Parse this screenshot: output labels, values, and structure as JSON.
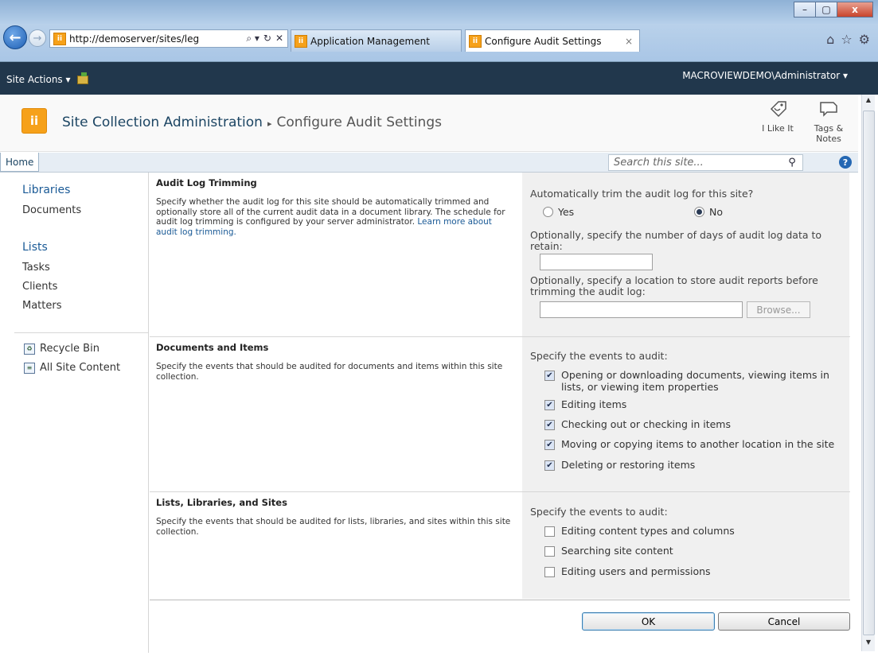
{
  "browser": {
    "url": "http://demoserver/sites/leg",
    "addr_tools": [
      "⌕ ▾",
      "↻",
      "✕"
    ],
    "tabs": [
      {
        "label": "Application Management"
      },
      {
        "label": "Configure Audit Settings",
        "close": "×"
      }
    ],
    "window_buttons": [
      "–",
      "▢",
      "x"
    ]
  },
  "ribbon": {
    "site_actions": "Site Actions ▾",
    "user": "MACROVIEWDEMO\\Administrator ▾"
  },
  "title_area": {
    "breadcrumb_root": "Site Collection Administration",
    "breadcrumb_sep": "▸",
    "breadcrumb_current": "Configure Audit Settings",
    "like_label": "I Like It",
    "tags_label": "Tags &\nNotes"
  },
  "topnav": {
    "home": "Home",
    "search_placeholder": "Search this site...",
    "help": "?"
  },
  "quick_launch": {
    "libraries_heading": "Libraries",
    "libraries": [
      "Documents"
    ],
    "lists_heading": "Lists",
    "lists": [
      "Tasks",
      "Clients",
      "Matters"
    ],
    "recycle_bin": "Recycle Bin",
    "all_site_content": "All Site Content"
  },
  "sections": {
    "trimming": {
      "title": "Audit Log Trimming",
      "desc_text": "Specify whether the audit log for this site should be automatically trimmed and optionally store all of the current audit data in a document library. The schedule for audit log trimming is configured by your server administrator. ",
      "desc_link": "Learn more about audit log trimming.",
      "question": "Automatically trim the audit log for this site?",
      "yes": "Yes",
      "no": "No",
      "selected": "No",
      "days_label": "Optionally, specify the number of days of audit log data to retain:",
      "days_value": "",
      "location_label": "Optionally, specify a location to store audit reports before trimming the audit log:",
      "location_value": "",
      "browse": "Browse..."
    },
    "documents": {
      "title": "Documents and Items",
      "desc": "Specify the events that should be audited for documents and items within this site collection.",
      "prompt": "Specify the events to audit:",
      "events": [
        {
          "label": "Opening or downloading documents, viewing items in lists, or viewing item properties",
          "checked": true
        },
        {
          "label": "Editing items",
          "checked": true
        },
        {
          "label": "Checking out or checking in items",
          "checked": true
        },
        {
          "label": "Moving or copying items to another location in the site",
          "checked": true
        },
        {
          "label": "Deleting or restoring items",
          "checked": true
        }
      ]
    },
    "lists": {
      "title": "Lists, Libraries, and Sites",
      "desc": "Specify the events that should be audited for lists, libraries, and sites within this site collection.",
      "prompt": "Specify the events to audit:",
      "events": [
        {
          "label": "Editing content types and columns",
          "checked": false
        },
        {
          "label": "Searching site content",
          "checked": false
        },
        {
          "label": "Editing users and permissions",
          "checked": false
        }
      ]
    }
  },
  "buttons": {
    "ok": "OK",
    "cancel": "Cancel"
  },
  "colors": {
    "ribbon": "#21374c",
    "accent": "#1a5a96",
    "logo": "#f6a11a"
  }
}
